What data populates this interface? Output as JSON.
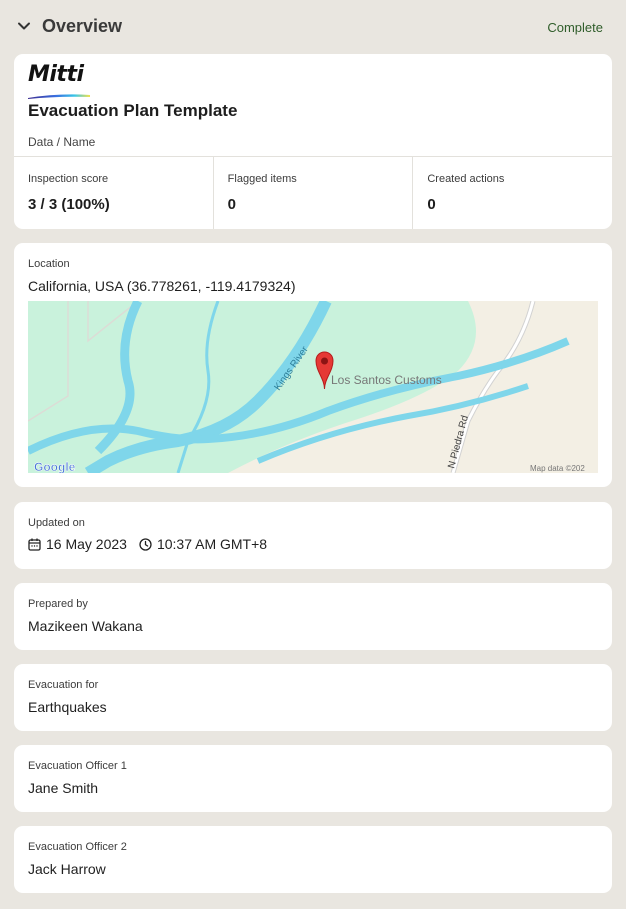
{
  "header": {
    "title": "Overview",
    "status": "Complete"
  },
  "report": {
    "logo_text": "Mitti",
    "title": "Evacuation Plan Template",
    "subtitle": "Data / Name"
  },
  "stats": [
    {
      "label": "Inspection score",
      "value": "3 / 3 (100%)"
    },
    {
      "label": "Flagged items",
      "value": "0"
    },
    {
      "label": "Created actions",
      "value": "0"
    }
  ],
  "location": {
    "label": "Location",
    "value": "California, USA (36.778261, -119.4179324)",
    "map": {
      "marker_label": "Los Santos Customs",
      "river_label": "Kings River",
      "road_label": "N Piedra Rd",
      "brand": "Google",
      "attribution": "Map data ©202"
    }
  },
  "updated": {
    "label": "Updated on",
    "date": "16 May 2023",
    "time": "10:37 AM GMT+8"
  },
  "prepared_by": {
    "label": "Prepared by",
    "value": "Mazikeen Wakana"
  },
  "evacuation_for": {
    "label": "Evacuation for",
    "value": "Earthquakes"
  },
  "officer_1": {
    "label": "Evacuation Officer 1",
    "value": "Jane Smith"
  },
  "officer_2": {
    "label": "Evacuation Officer 2",
    "value": "Jack Harrow"
  },
  "colors": {
    "background": "#e9e6e0",
    "status_green": "#2f5d2a",
    "map_land": "#f3efe4",
    "map_park": "#c9f2dc",
    "map_water": "#7fd6ea",
    "marker": "#e53935"
  }
}
